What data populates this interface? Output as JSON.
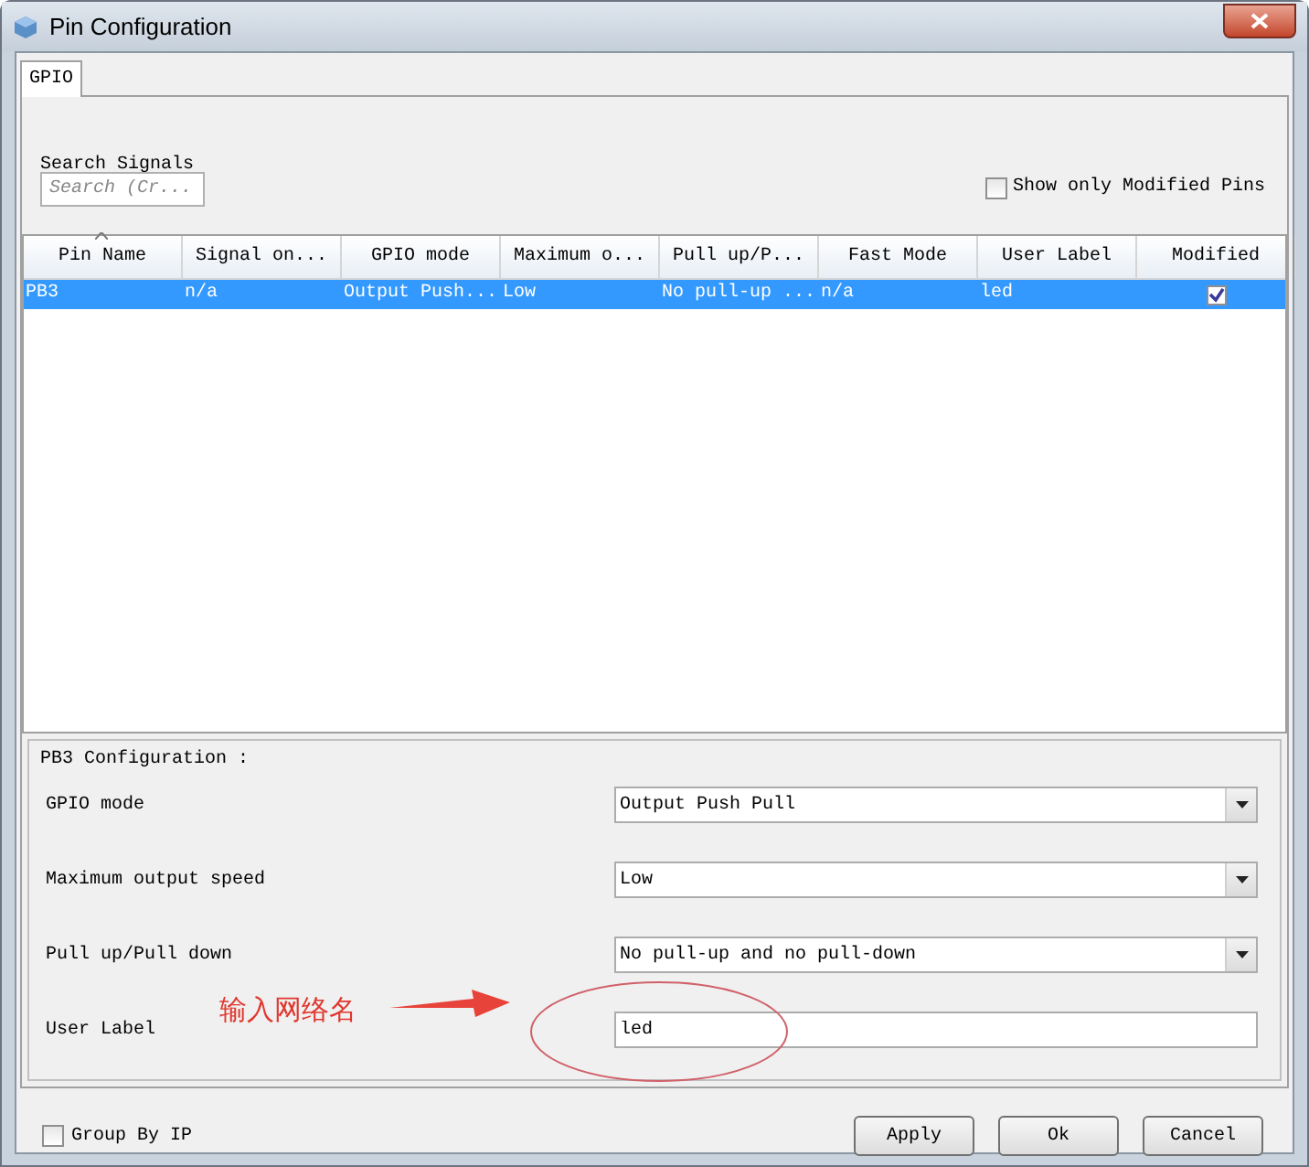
{
  "window": {
    "title": "Pin Configuration"
  },
  "tabs": [
    {
      "label": "GPIO",
      "selected": true
    }
  ],
  "search": {
    "label": "Search Signals",
    "placeholder": "Search (Cr..."
  },
  "show_modified": {
    "label": "Show only Modified Pins",
    "checked": false
  },
  "table": {
    "columns": [
      {
        "label": "Pin Name",
        "sorted": true
      },
      {
        "label": "Signal on...",
        "sorted": false
      },
      {
        "label": "GPIO mode",
        "sorted": false
      },
      {
        "label": "Maximum o...",
        "sorted": false
      },
      {
        "label": "Pull up/P...",
        "sorted": false
      },
      {
        "label": "Fast Mode",
        "sorted": false
      },
      {
        "label": "User Label",
        "sorted": false
      },
      {
        "label": "Modified",
        "sorted": false
      }
    ],
    "rows": [
      {
        "selected": true,
        "cells": [
          "PB3",
          "n/a",
          "Output Push...",
          "Low",
          "No pull-up ...",
          "n/a",
          "led"
        ],
        "modified": true
      }
    ]
  },
  "configuration": {
    "title": "PB3 Configuration :",
    "fields": [
      {
        "label": "GPIO mode",
        "kind": "dropdown",
        "value": "Output Push Pull"
      },
      {
        "label": "Maximum output speed",
        "kind": "dropdown",
        "value": "Low"
      },
      {
        "label": "Pull up/Pull down",
        "kind": "dropdown",
        "value": "No pull-up and no pull-down"
      },
      {
        "label": "User Label",
        "kind": "text",
        "value": "led"
      }
    ]
  },
  "annotation": {
    "text": "输入网络名"
  },
  "group_by_ip": {
    "label": "Group By IP",
    "checked": false
  },
  "buttons": [
    "Apply",
    "Ok",
    "Cancel"
  ]
}
